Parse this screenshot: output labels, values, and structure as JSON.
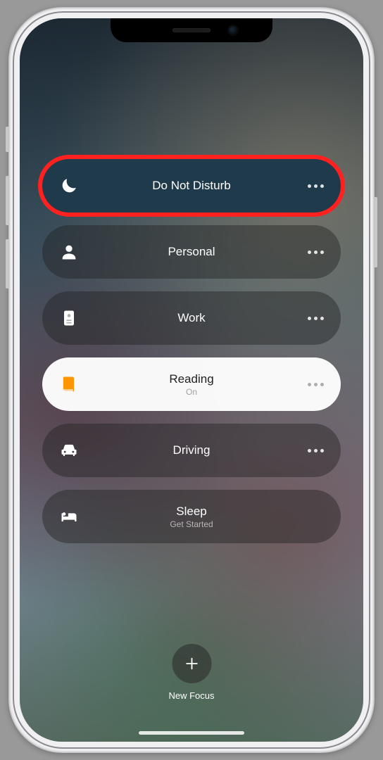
{
  "focusItems": [
    {
      "id": "dnd",
      "label": "Do Not Disturb",
      "sub": "",
      "icon": "moon",
      "active": false,
      "highlight": true,
      "more": true
    },
    {
      "id": "personal",
      "label": "Personal",
      "sub": "",
      "icon": "person",
      "active": false,
      "highlight": false,
      "more": true
    },
    {
      "id": "work",
      "label": "Work",
      "sub": "",
      "icon": "badge",
      "active": false,
      "highlight": false,
      "more": true
    },
    {
      "id": "reading",
      "label": "Reading",
      "sub": "On",
      "icon": "book",
      "active": true,
      "highlight": false,
      "more": true
    },
    {
      "id": "driving",
      "label": "Driving",
      "sub": "",
      "icon": "car",
      "active": false,
      "highlight": false,
      "more": true
    },
    {
      "id": "sleep",
      "label": "Sleep",
      "sub": "Get Started",
      "icon": "bed",
      "active": false,
      "highlight": false,
      "more": false
    }
  ],
  "newFocus": {
    "label": "New Focus"
  }
}
